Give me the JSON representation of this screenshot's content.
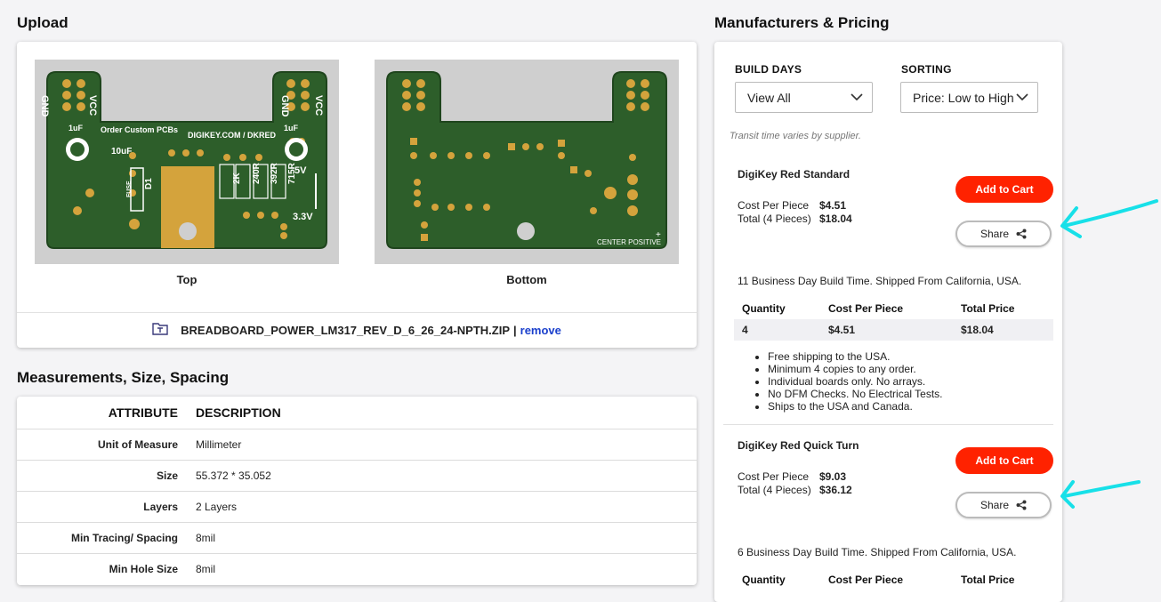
{
  "upload": {
    "title": "Upload",
    "top_caption": "Top",
    "bottom_caption": "Bottom",
    "file_name": "BREADBOARD_POWER_LM317_REV_D_6_26_24-NPTH.ZIP",
    "separator": "|",
    "remove_label": "remove",
    "pcb_labels": {
      "gnd": "GND",
      "vcc": "VCC",
      "cap_1uf": "1uF",
      "cap_10uf": "10uF",
      "order_text": "Order Custom PCBs",
      "digikey_text": "DIGIKEY.COM / DKRED",
      "r_2k": "2K",
      "r_240r": "240R",
      "r_392r": "392R",
      "r_715r": "715R",
      "v5": "5V",
      "v33": "3.3V",
      "fuse": "FUSE",
      "d1": "D1",
      "center_positive": "CENTER POSITIVE",
      "plus": "+"
    }
  },
  "measurements": {
    "title": "Measurements, Size, Spacing",
    "headers": [
      "ATTRIBUTE",
      "DESCRIPTION"
    ],
    "rows": [
      [
        "Unit of Measure",
        "Millimeter"
      ],
      [
        "Size",
        "55.372 * 35.052"
      ],
      [
        "Layers",
        "2 Layers"
      ],
      [
        "Min Tracing/ Spacing",
        "8mil"
      ],
      [
        "Min Hole Size",
        "8mil"
      ]
    ]
  },
  "pricing": {
    "title": "Manufacturers & Pricing",
    "build_days_label": "BUILD DAYS",
    "build_days_value": "View All",
    "sorting_label": "SORTING",
    "sorting_value": "Price: Low to High",
    "transit_note": "Transit time varies by supplier.",
    "cost_per_piece_label": "Cost Per Piece",
    "total_label": "Total (4 Pieces)",
    "add_to_cart": "Add to Cart",
    "share": "Share",
    "table_headers": [
      "Quantity",
      "Cost Per Piece",
      "Total Price"
    ],
    "offers": [
      {
        "name": "DigiKey Red Standard",
        "cost_per_piece": "$4.51",
        "total": "$18.04",
        "build_info": "11 Business Day Build Time. Shipped From California, USA.",
        "row": [
          "4",
          "$4.51",
          "$18.04"
        ],
        "features": [
          "Free shipping to the USA.",
          "Minimum 4 copies to any order.",
          "Individual boards only. No arrays.",
          "No DFM Checks. No Electrical Tests.",
          "Ships to the USA and Canada."
        ]
      },
      {
        "name": "DigiKey Red Quick Turn",
        "cost_per_piece": "$9.03",
        "total": "$36.12",
        "build_info": "6 Business Day Build Time. Shipped From California, USA."
      }
    ]
  },
  "colors": {
    "pcb_green": "#2d5e2a",
    "pad_gold": "#d4a33c",
    "cart_red": "#ff2200",
    "link_blue": "#1a3fcc",
    "arrow_cyan": "#17e0e8"
  }
}
